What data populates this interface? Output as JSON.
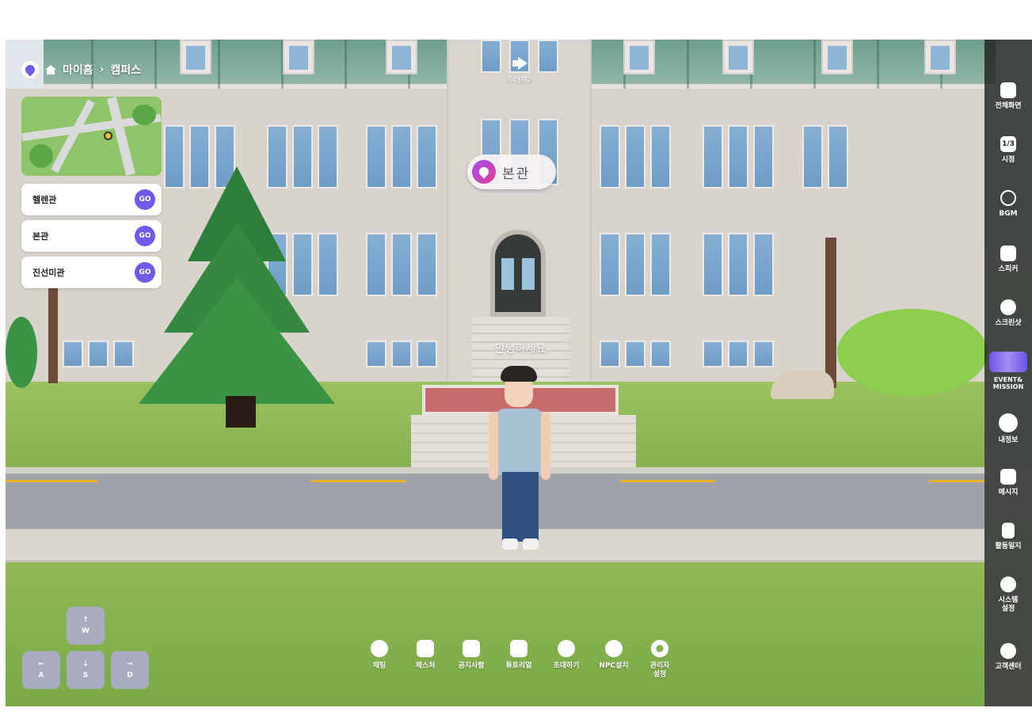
{
  "breadcrumb": {
    "home": "마이홈",
    "separator": "›",
    "current": "캠퍼스"
  },
  "go_list": {
    "items": [
      {
        "label": "헬렌관",
        "button": "GO"
      },
      {
        "label": "본관",
        "button": "GO"
      },
      {
        "label": "진선미관",
        "button": "GO"
      }
    ]
  },
  "scene": {
    "notice_label": "투어하기",
    "location_tag": "본관",
    "greeting": "안녕하세요"
  },
  "right_panel": {
    "items": [
      {
        "label": "전체화면",
        "icon": "fullscreen-icon"
      },
      {
        "label": "시점",
        "icon_text": "1/3",
        "icon": "camera-view-icon"
      },
      {
        "label": "BGM",
        "icon": "music-off-icon"
      },
      {
        "label": "스피커",
        "icon": "speaker-icon"
      },
      {
        "label": "스크린샷",
        "icon": "screenshot-icon"
      },
      {
        "label": "EVENT&\nMISSION",
        "icon": "event-mission-icon"
      },
      {
        "label": "내정보",
        "icon": "profile-icon"
      },
      {
        "label": "메시지",
        "icon": "message-icon"
      },
      {
        "label": "활동일지",
        "icon": "activity-log-icon"
      },
      {
        "label": "시스템\n설정",
        "icon": "system-settings-icon"
      },
      {
        "label": "고객센터",
        "icon": "customer-center-icon"
      }
    ]
  },
  "keys": {
    "up": {
      "arrow": "↑",
      "key": "W"
    },
    "left": {
      "arrow": "←",
      "key": "A"
    },
    "down": {
      "arrow": "↓",
      "key": "S"
    },
    "right": {
      "arrow": "→",
      "key": "D"
    }
  },
  "bottom_bar": {
    "items": [
      {
        "label": "채팅",
        "icon": "chat-icon"
      },
      {
        "label": "제스처",
        "icon": "gesture-icon"
      },
      {
        "label": "공지사항",
        "icon": "notice-icon"
      },
      {
        "label": "튜토리얼",
        "icon": "tutorial-icon"
      },
      {
        "label": "초대하기",
        "icon": "invite-icon"
      },
      {
        "label": "NPC설치",
        "icon": "npc-install-icon"
      },
      {
        "label": "관리자\n설정",
        "icon": "admin-settings-icon"
      }
    ]
  },
  "colors": {
    "accent": "#7159ea",
    "panel": "#1e221c"
  }
}
